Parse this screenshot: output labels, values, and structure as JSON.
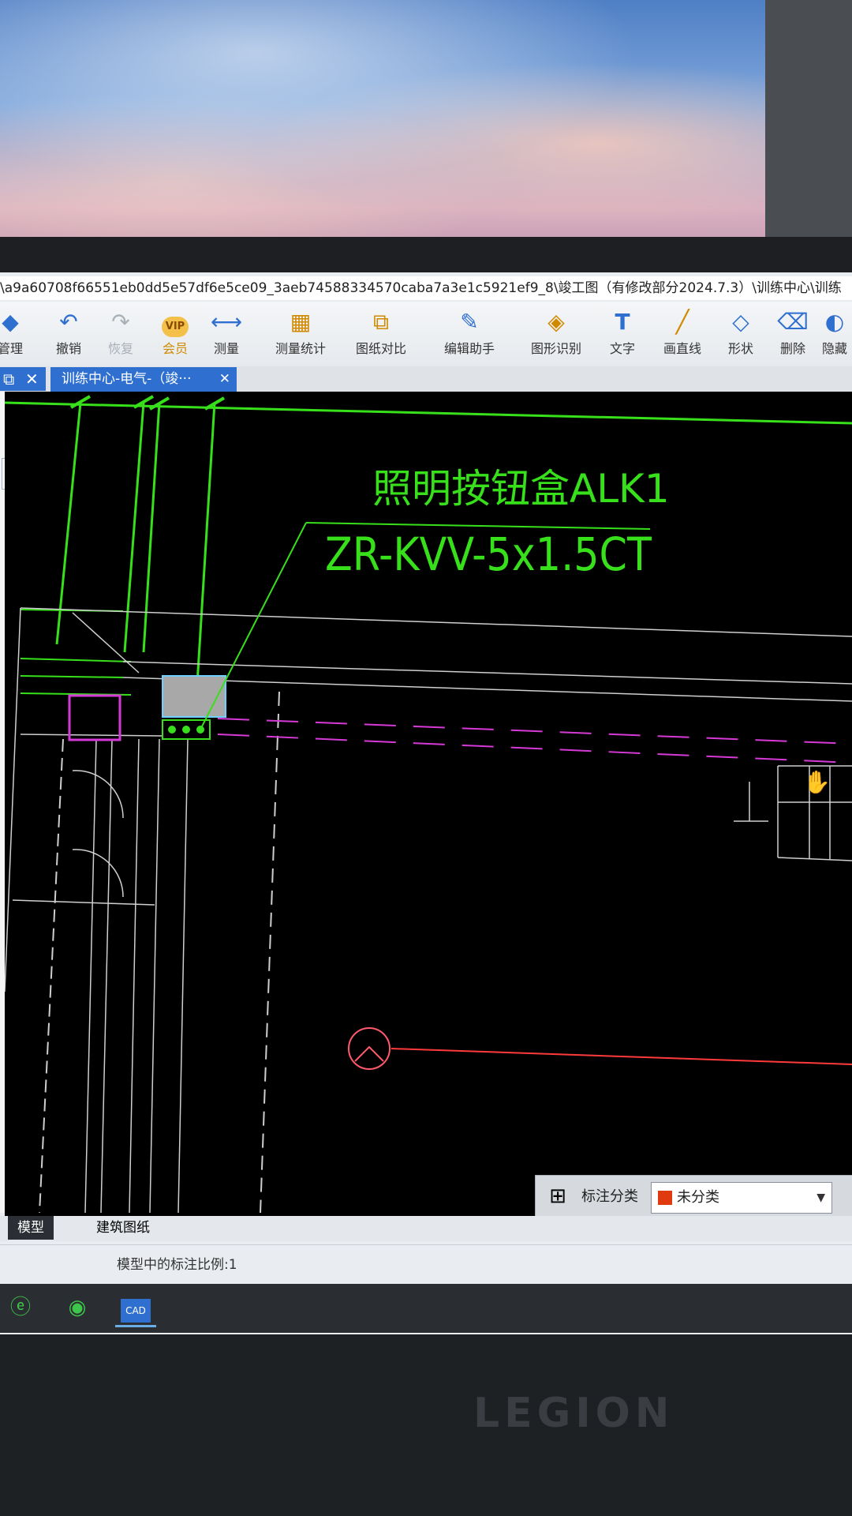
{
  "window": {
    "title": "\\a9a60708f66551eb0dd5e57df6e5ce09_3aeb74588334570caba7a3e1c5921ef9_8\\竣工图（有修改部分2024.7.3）\\训练中心\\训练"
  },
  "toolbar": {
    "items": [
      {
        "label": "管理",
        "icon": "layers-icon"
      },
      {
        "label": "撤销",
        "icon": "undo-icon"
      },
      {
        "label": "恢复",
        "icon": "redo-icon"
      },
      {
        "label": "会员",
        "icon": "vip-icon",
        "badge": "VIP"
      },
      {
        "label": "测量",
        "icon": "ruler-icon"
      },
      {
        "label": "测量统计",
        "icon": "measure-stats-icon"
      },
      {
        "label": "图纸对比",
        "icon": "compare-icon"
      },
      {
        "label": "编辑助手",
        "icon": "edit-assistant-icon"
      },
      {
        "label": "图形识别",
        "icon": "shape-recognize-icon"
      },
      {
        "label": "文字",
        "icon": "text-icon"
      },
      {
        "label": "画直线",
        "icon": "line-icon"
      },
      {
        "label": "形状",
        "icon": "shape-icon"
      },
      {
        "label": "删除",
        "icon": "eraser-icon"
      },
      {
        "label": "隐藏",
        "icon": "hide-icon"
      }
    ]
  },
  "tabs": {
    "document_tab": "训练中心-电气-（竣···"
  },
  "drawing": {
    "annotation_line1": "照明按钮盒ALK1",
    "annotation_line2": "ZR-KVV-5x1.5CT"
  },
  "annotation_bar": {
    "label": "标注分类",
    "selected": "未分类",
    "swatch_color": "#e03a10"
  },
  "model_tabs": {
    "model": "模型",
    "layout": "建筑图纸"
  },
  "status": {
    "text": "模型中的标注比例:1"
  },
  "colors": {
    "cad_green": "#37e01a",
    "cad_magenta": "#d63ad6",
    "cad_red": "#ff3a3a",
    "accent_blue": "#2f6fd0"
  }
}
